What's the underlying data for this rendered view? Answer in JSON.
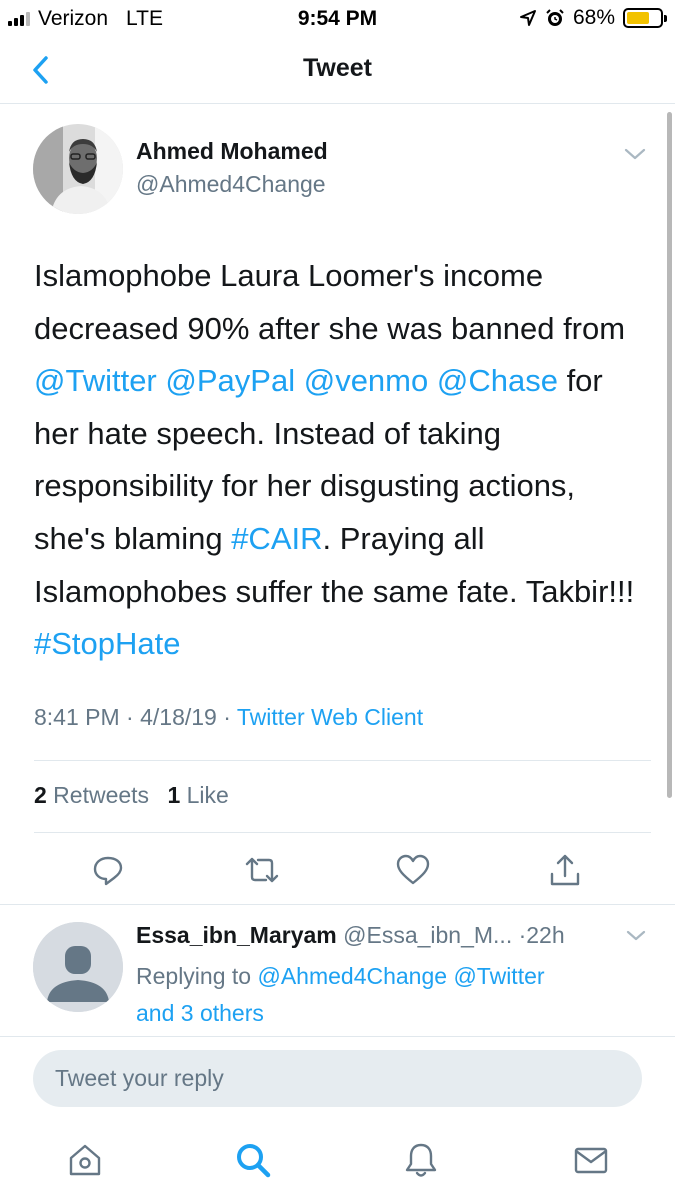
{
  "status_bar": {
    "carrier": "Verizon",
    "network": "LTE",
    "time": "9:54 PM",
    "battery": "68%",
    "battery_level": 0.68
  },
  "nav": {
    "title": "Tweet"
  },
  "tweet": {
    "author_name": "Ahmed Mohamed",
    "author_handle": "@Ahmed4Change",
    "text": {
      "t1": "Islamophobe Laura Loomer's income decreased 90% after she was banned from ",
      "m1": "@Twitter",
      "t2": " ",
      "m2": "@PayPal",
      "t3": " ",
      "m3": "@venmo",
      "t4": " ",
      "m4": "@Chase",
      "t5": " for her hate speech. Instead of taking responsibility for her disgusting actions, she's blaming ",
      "h1": "#CAIR",
      "t6": ". Praying all Islamophobes suffer the same fate. Takbir!!! ",
      "h2": "#StopHate"
    },
    "time": "8:41 PM",
    "sep1": " · ",
    "date": "4/18/19",
    "sep2": " · ",
    "client": "Twitter Web Client",
    "retweet_count": "2",
    "retweet_label": " Retweets",
    "like_count": "1",
    "like_label": " Like"
  },
  "reply": {
    "name": "Essa_ibn_Maryam",
    "handle": " @Essa_ibn_M...",
    "time": " ·22h",
    "replying_prefix": "Replying to ",
    "mention1": "@Ahmed4Change",
    "space": " ",
    "mention2": "@Twitter",
    "others": "and 3 others"
  },
  "compose": {
    "placeholder": "Tweet your reply"
  },
  "icons": {
    "back": "chevron-left-icon",
    "menu": "chevron-down-icon",
    "reply": "reply-icon",
    "retweet": "retweet-icon",
    "like": "heart-icon",
    "share": "share-icon",
    "home": "home-icon",
    "search": "search-icon",
    "notifications": "bell-icon",
    "messages": "mail-icon"
  },
  "colors": {
    "accent": "#1da1f2",
    "secondary_text": "#657786",
    "primary_text": "#14171a",
    "divider": "#e1e8ed",
    "battery": "#f2c200"
  }
}
